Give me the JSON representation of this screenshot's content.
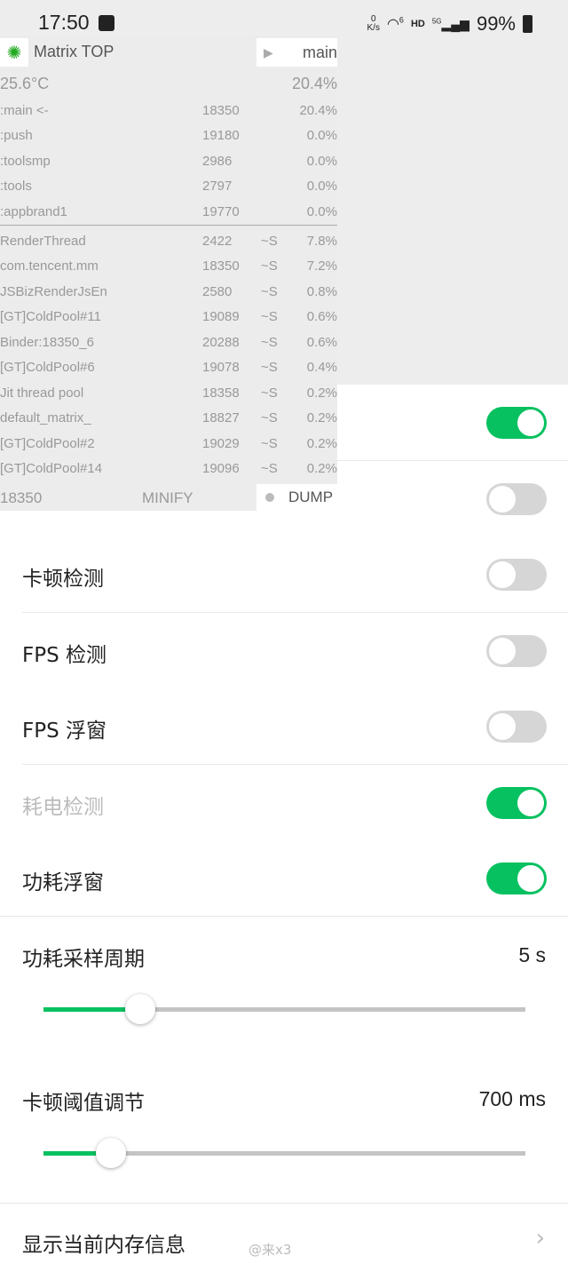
{
  "status_bar": {
    "time": "17:50",
    "net_speed_value": "0",
    "net_speed_unit": "K/s",
    "wifi": "6",
    "hd": "HD",
    "signal": "5G",
    "battery": "99%"
  },
  "overlay": {
    "title": "Matrix TOP",
    "main_label": "main",
    "temperature": "25.6°C",
    "total_cpu": "20.4%",
    "processes": [
      {
        "name": ":main <-",
        "pid": "18350",
        "cpu": "20.4%"
      },
      {
        "name": ":push",
        "pid": "19180",
        "cpu": "0.0%"
      },
      {
        "name": ":toolsmp",
        "pid": "2986",
        "cpu": "0.0%"
      },
      {
        "name": ":tools",
        "pid": "2797",
        "cpu": "0.0%"
      },
      {
        "name": ":appbrand1",
        "pid": "19770",
        "cpu": "0.0%"
      }
    ],
    "threads": [
      {
        "name": "RenderThread",
        "tid": "2422",
        "state": "~S",
        "cpu": "7.8%"
      },
      {
        "name": "com.tencent.mm",
        "tid": "18350",
        "state": "~S",
        "cpu": "7.2%"
      },
      {
        "name": "JSBizRenderJsEn",
        "tid": "2580",
        "state": "~S",
        "cpu": "0.8%"
      },
      {
        "name": "[GT]ColdPool#11",
        "tid": "19089",
        "state": "~S",
        "cpu": "0.6%"
      },
      {
        "name": "Binder:18350_6",
        "tid": "20288",
        "state": "~S",
        "cpu": "0.6%"
      },
      {
        "name": "[GT]ColdPool#6",
        "tid": "19078",
        "state": "~S",
        "cpu": "0.4%"
      },
      {
        "name": "Jit thread pool",
        "tid": "18358",
        "state": "~S",
        "cpu": "0.2%"
      },
      {
        "name": "default_matrix_",
        "tid": "18827",
        "state": "~S",
        "cpu": "0.2%"
      },
      {
        "name": "[GT]ColdPool#2",
        "tid": "19029",
        "state": "~S",
        "cpu": "0.2%"
      },
      {
        "name": "[GT]ColdPool#14",
        "tid": "19096",
        "state": "~S",
        "cpu": "0.2%"
      }
    ],
    "footer_pid": "18350",
    "minify_label": "MINIFY",
    "dump_label": "DUMP"
  },
  "settings": [
    {
      "label": "",
      "on": true,
      "disabled": false
    },
    {
      "label": "",
      "on": false,
      "disabled": false
    },
    {
      "label": "卡顿检测",
      "on": false,
      "disabled": false
    },
    {
      "label": "FPS 检测",
      "on": false,
      "disabled": false
    },
    {
      "label": "FPS 浮窗",
      "on": false,
      "disabled": false
    },
    {
      "label": "耗电检测",
      "on": true,
      "disabled": true
    },
    {
      "label": "功耗浮窗",
      "on": true,
      "disabled": false
    }
  ],
  "sliders": [
    {
      "label": "功耗采样周期",
      "value": "5 s",
      "fraction": 0.2
    },
    {
      "label": "卡顿阈值调节",
      "value": "700 ms",
      "fraction": 0.14
    }
  ],
  "memory_item": {
    "label": "显示当前内存信息"
  },
  "watermark": "@来x3",
  "colors": {
    "accent": "#07c160",
    "toggle_off": "#d6d6d6"
  }
}
